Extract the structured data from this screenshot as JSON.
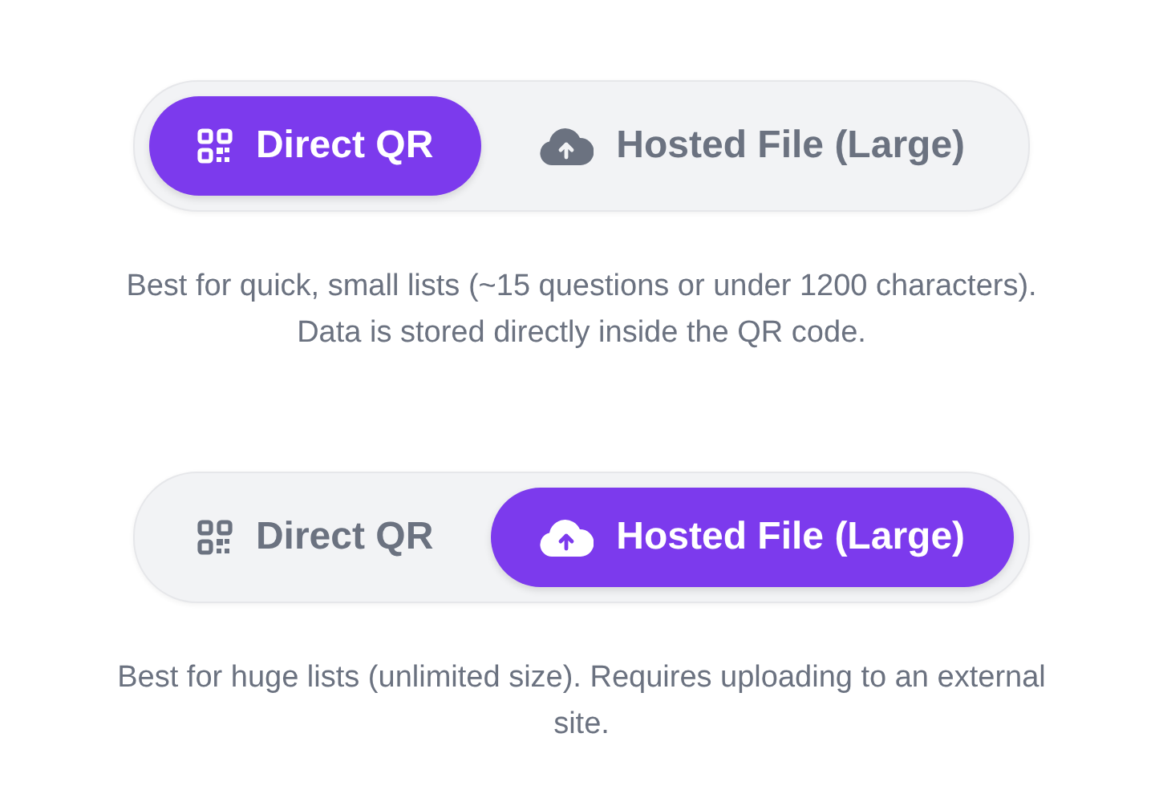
{
  "sections": [
    {
      "tabs": [
        {
          "label": "Direct QR",
          "kind": "qr",
          "selected": true
        },
        {
          "label": "Hosted File (Large)",
          "kind": "cloud",
          "selected": false
        }
      ],
      "description": "Best for quick, small lists (~15 questions or under 1200 characters). Data is stored directly inside the QR code."
    },
    {
      "tabs": [
        {
          "label": "Direct QR",
          "kind": "qr",
          "selected": false
        },
        {
          "label": "Hosted File (Large)",
          "kind": "cloud",
          "selected": true
        }
      ],
      "description": "Best for huge lists (unlimited size). Requires uploading to an external site."
    }
  ]
}
